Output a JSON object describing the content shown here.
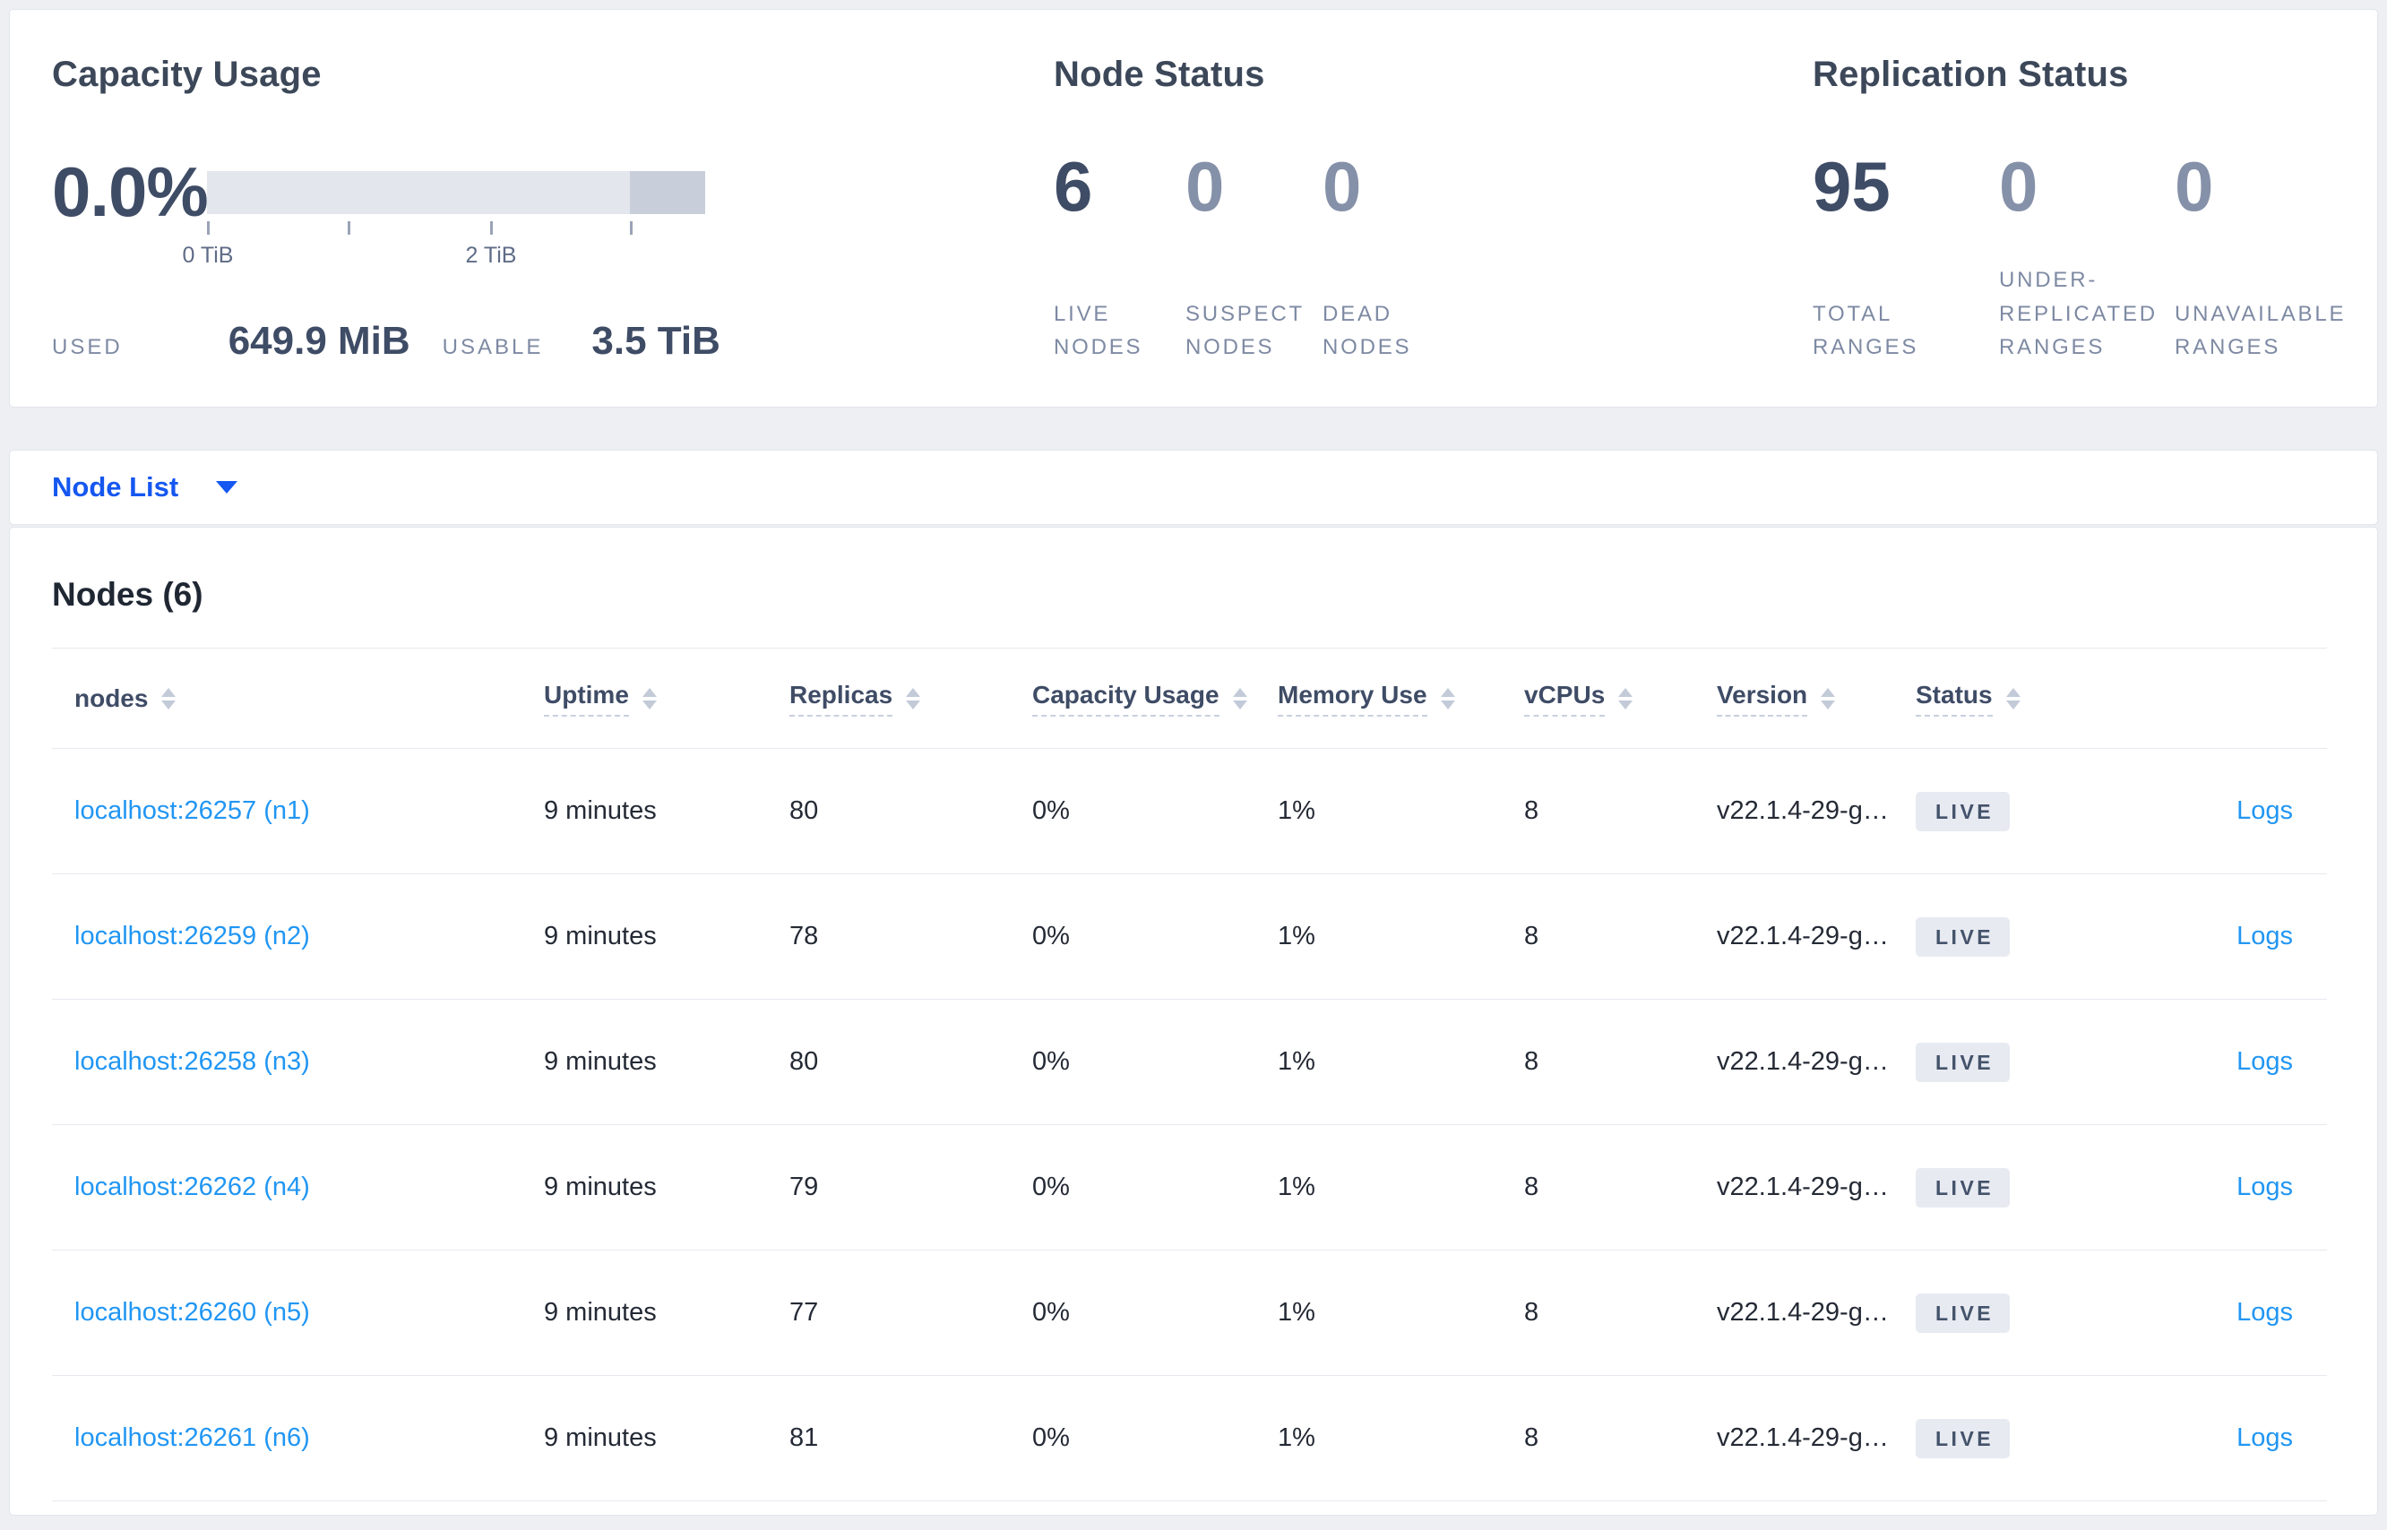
{
  "summary": {
    "capacity": {
      "title": "Capacity Usage",
      "percent": "0.0%",
      "tick_labels": [
        "0 TiB",
        "2 TiB"
      ],
      "used_label": "USED",
      "used_value": "649.9 MiB",
      "usable_label": "USABLE",
      "usable_value": "3.5 TiB"
    },
    "node_status": {
      "title": "Node Status",
      "stats": [
        {
          "value": "6",
          "label": "LIVE NODES"
        },
        {
          "value": "0",
          "label": "SUSPECT NODES"
        },
        {
          "value": "0",
          "label": "DEAD NODES"
        }
      ]
    },
    "replication": {
      "title": "Replication Status",
      "stats": [
        {
          "value": "95",
          "label": "TOTAL RANGES"
        },
        {
          "value": "0",
          "label": "UNDER-REPLICATED RANGES"
        },
        {
          "value": "0",
          "label": "UNAVAILABLE RANGES"
        }
      ]
    }
  },
  "view_selector": {
    "label": "Node List",
    "icon": "caret-down"
  },
  "table": {
    "title": "Nodes (6)",
    "logs_label": "Logs",
    "columns": [
      {
        "label": "nodes"
      },
      {
        "label": "Uptime"
      },
      {
        "label": "Replicas"
      },
      {
        "label": "Capacity Usage"
      },
      {
        "label": "Memory Use"
      },
      {
        "label": "vCPUs"
      },
      {
        "label": "Version"
      },
      {
        "label": "Status"
      }
    ],
    "rows": [
      {
        "node": "localhost:26257 (n1)",
        "uptime": "9 minutes",
        "replicas": "80",
        "capacity": "0%",
        "memory": "1%",
        "vcpus": "8",
        "version": "v22.1.4-29-g…",
        "status": "LIVE"
      },
      {
        "node": "localhost:26259 (n2)",
        "uptime": "9 minutes",
        "replicas": "78",
        "capacity": "0%",
        "memory": "1%",
        "vcpus": "8",
        "version": "v22.1.4-29-g…",
        "status": "LIVE"
      },
      {
        "node": "localhost:26258 (n3)",
        "uptime": "9 minutes",
        "replicas": "80",
        "capacity": "0%",
        "memory": "1%",
        "vcpus": "8",
        "version": "v22.1.4-29-g…",
        "status": "LIVE"
      },
      {
        "node": "localhost:26262 (n4)",
        "uptime": "9 minutes",
        "replicas": "79",
        "capacity": "0%",
        "memory": "1%",
        "vcpus": "8",
        "version": "v22.1.4-29-g…",
        "status": "LIVE"
      },
      {
        "node": "localhost:26260 (n5)",
        "uptime": "9 minutes",
        "replicas": "77",
        "capacity": "0%",
        "memory": "1%",
        "vcpus": "8",
        "version": "v22.1.4-29-g…",
        "status": "LIVE"
      },
      {
        "node": "localhost:26261 (n6)",
        "uptime": "9 minutes",
        "replicas": "81",
        "capacity": "0%",
        "memory": "1%",
        "vcpus": "8",
        "version": "v22.1.4-29-g…",
        "status": "LIVE"
      }
    ]
  },
  "colors": {
    "primary_blue": "#1557f0",
    "link_blue": "#2196f3",
    "heading": "#3c4859",
    "stat_emphasis": "#3f4c66",
    "stat_muted": "#8591a8",
    "label_gray": "#7e8aa3",
    "badge_bg": "#e7eaf1",
    "badge_text": "#44536b",
    "bar_light": "#e3e6ec",
    "bar_dark": "#c9cfda",
    "page_bg": "#edeff3"
  }
}
